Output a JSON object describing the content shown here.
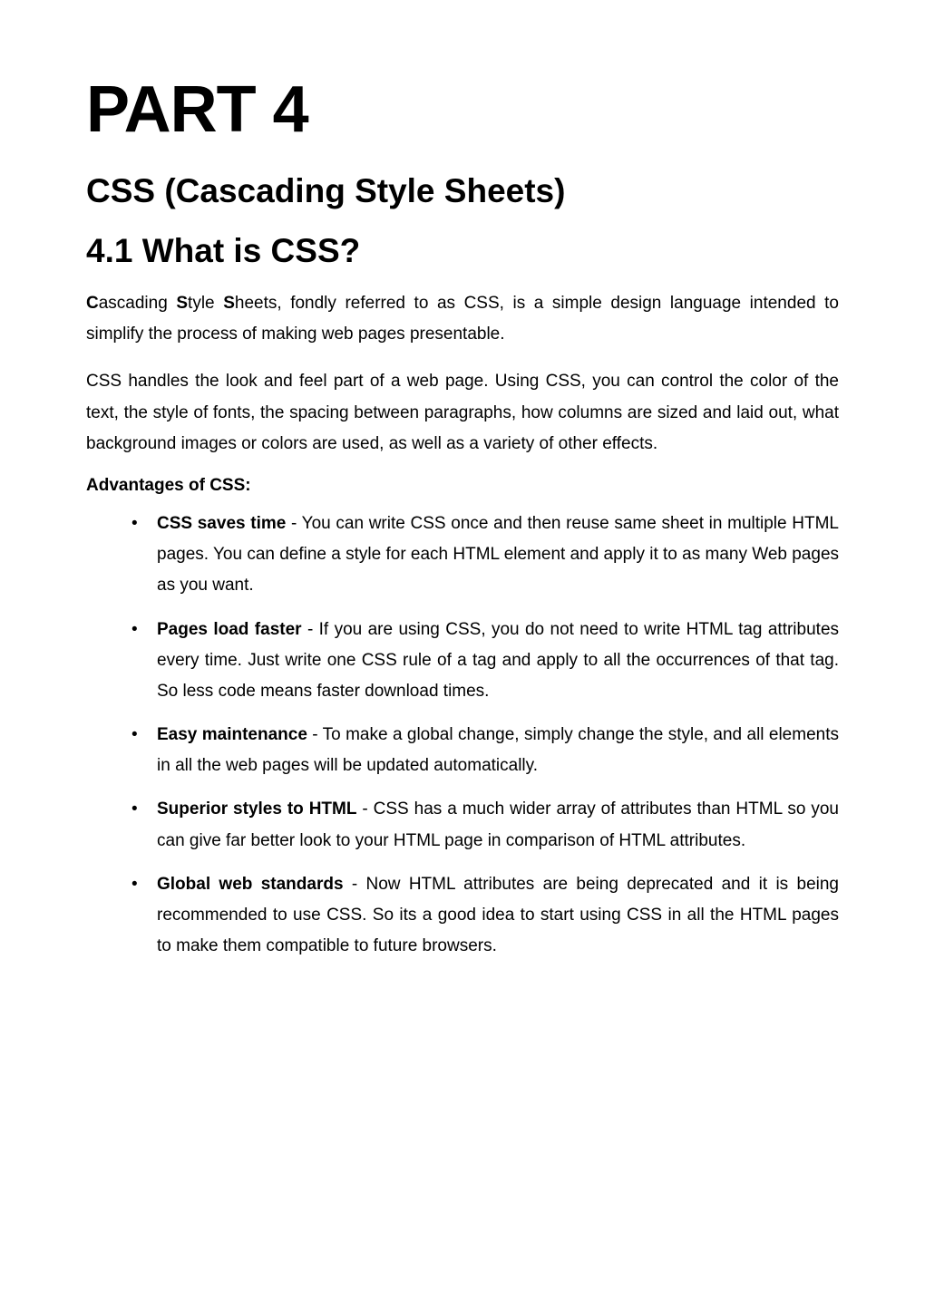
{
  "part_title": "PART 4",
  "subtitle": "CSS (Cascading Style Sheets)",
  "section_title": "4.1 What is CSS?",
  "para1_prefix_c": "C",
  "para1_ascading": "ascading ",
  "para1_s1": "S",
  "para1_tyle": "tyle ",
  "para1_s2": "S",
  "para1_rest": "heets, fondly referred to as CSS, is a simple design language intended to simplify the process of making web pages presentable.",
  "para2": "CSS handles the look and feel part of a web page. Using CSS, you can control the color of the text, the style of fonts, the spacing between paragraphs, how columns are sized and laid out, what background images or colors are used, as well as a variety of other effects.",
  "advantages_heading": "Advantages of CSS:",
  "advantages": [
    {
      "bold": "CSS saves time",
      "text": " - You can write CSS once and then reuse same sheet in multiple HTML pages. You can define a style for each HTML element and apply it to as many Web pages as you want."
    },
    {
      "bold": "Pages load faster",
      "text": " - If you are using CSS, you do not need to write HTML tag attributes every time. Just write one CSS rule of a tag and apply to all the occurrences of that tag. So less code means faster download times."
    },
    {
      "bold": "Easy maintenance",
      "text": " - To make a global change, simply change the style, and all elements in all the web pages will be updated automatically."
    },
    {
      "bold": "Superior styles to HTML",
      "text": " - CSS has a much wider array of attributes than HTML so you can give far better look to your HTML page in comparison of HTML attributes."
    },
    {
      "bold": "Global web standards",
      "text": " - Now HTML attributes are being deprecated and it is being recommended to use CSS. So its a good idea to start using CSS in all the HTML pages to make them compatible to future browsers."
    }
  ]
}
